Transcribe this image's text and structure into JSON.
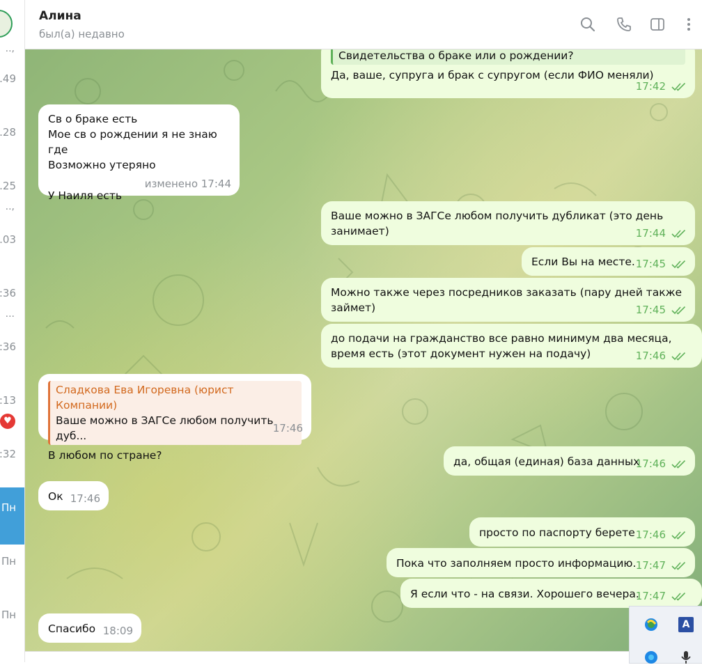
{
  "sidebar": {
    "times": [
      ".49",
      ".28",
      ".25",
      ".03",
      ":36",
      ":36",
      ":13",
      ":32"
    ],
    "dots": [
      "..,",
      "..."
    ],
    "days": [
      "Пн",
      "Пн",
      "Пн"
    ]
  },
  "header": {
    "name": "Алина",
    "status": "был(а) недавно",
    "icons": [
      "search-icon",
      "phone-icon",
      "sidebar-toggle-icon",
      "more-vertical-icon"
    ]
  },
  "messages": [
    {
      "dir": "out",
      "reply_text": "Свидетельства о браке или о рождении?",
      "text": "Да, ваше, супруга и брак с супругом (если ФИО меняли)",
      "time": "17:42"
    },
    {
      "dir": "in",
      "text": "Св о браке есть\nМое св о рождении я не знаю где\nВозможно утеряно\n\nУ Наиля есть",
      "time": "изменено 17:44"
    },
    {
      "dir": "out",
      "text": "Ваше можно в ЗАГСе любом получить дубликат (это день\nзанимает)",
      "time": "17:44"
    },
    {
      "dir": "out",
      "text": "Если Вы на месте.",
      "time": "17:45"
    },
    {
      "dir": "out",
      "text": "Можно также через посредников заказать (пару дней также\nзаймет)",
      "time": "17:45"
    },
    {
      "dir": "out",
      "text": "до подачи на гражданство все равно минимум два месяца,\nвремя есть (этот документ нужен на подачу)",
      "time": "17:46"
    },
    {
      "dir": "in",
      "reply_author": "Сладкова Ева Игоревна (юрист Компании)",
      "reply_text": "Ваше можно в ЗАГСе любом получить дуб...",
      "text": "В любом по стране?",
      "time": "17:46"
    },
    {
      "dir": "out",
      "text": "да, общая (единая) база данных",
      "time": "17:46"
    },
    {
      "dir": "in",
      "text": "Ок",
      "time": "17:46"
    },
    {
      "dir": "out",
      "text": "просто по паспорту берете",
      "time": "17:46"
    },
    {
      "dir": "out",
      "text": "Пока что заполняем просто информацию.",
      "time": "17:47"
    },
    {
      "dir": "out",
      "text": "Я если что - на связи. Хорошего вечера.",
      "time": "17:47"
    },
    {
      "dir": "in",
      "text": "Спасибо",
      "time": "18:09"
    }
  ],
  "tray": {
    "icons": [
      "edge-icon",
      "language-indicator-icon",
      "edge-icon",
      "microphone-icon"
    ],
    "lang_glyph": "A"
  },
  "colors": {
    "outgoing": "#effdde",
    "incoming": "#ffffff",
    "accent": "#419fd9",
    "tick": "#5fb159",
    "reply_author": "#d2691e"
  }
}
